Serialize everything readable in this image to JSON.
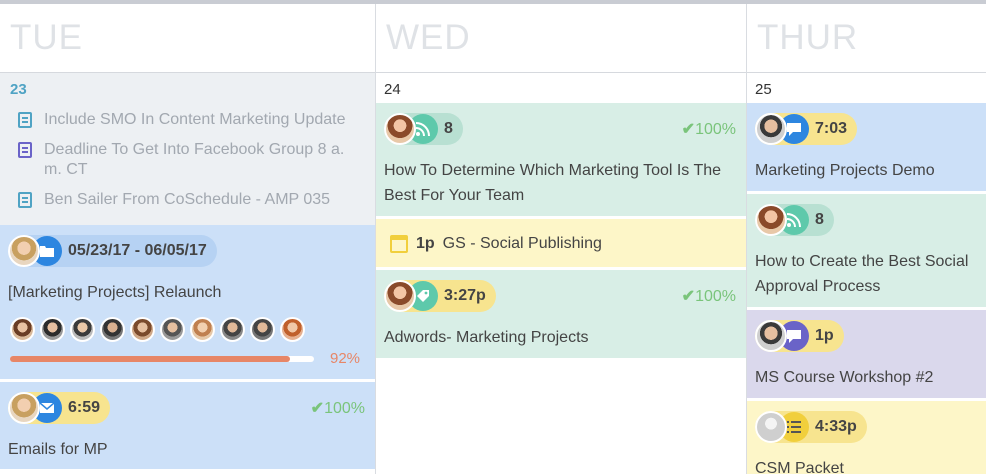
{
  "days": [
    {
      "label": "TUE",
      "num": "23"
    },
    {
      "label": "WED",
      "num": "24"
    },
    {
      "label": "THUR",
      "num": "25"
    }
  ],
  "tue": {
    "tasks": [
      {
        "text": "Include SMO In Content Marketing Update",
        "color": "#4fa3c4"
      },
      {
        "text": "Deadline To Get Into Facebook Group 8 a. m. CT",
        "color": "#6a63c8"
      },
      {
        "text": "Ben Sailer From CoSchedule - AMP 035",
        "color": "#4fa3c4"
      }
    ],
    "project": {
      "dates": "05/23/17 - 06/05/17",
      "title": "[Marketing Projects] Relaunch",
      "progress": 0.92,
      "progress_label": "92%"
    },
    "email": {
      "time": "6:59",
      "percent": "100%",
      "title": "Emails for MP"
    }
  },
  "wed": {
    "blog": {
      "count": "8",
      "percent": "100%",
      "title": "How To Determine Which Marketing Tool Is The Best For Your Team"
    },
    "event": {
      "time": "1p",
      "title": "GS - Social Publishing"
    },
    "adwords": {
      "time": "3:27p",
      "percent": "100%",
      "title": "Adwords- Marketing Projects"
    }
  },
  "thu": {
    "demo": {
      "time": "7:03",
      "title": "Marketing Projects Demo"
    },
    "blog": {
      "count": "8",
      "title": "How to Create the Best Social Approval Process"
    },
    "workshop": {
      "time": "1p",
      "title": "MS Course Workshop #2"
    },
    "packet": {
      "time": "4:33p",
      "title": "CSM Packet"
    }
  },
  "icons": {
    "check": "✔",
    "folder": "folder-icon",
    "rss": "rss-icon",
    "chat": "chat-icon",
    "tag": "tag-icon",
    "mail": "mail-icon",
    "list": "list-icon",
    "calendar": "calendar-icon"
  },
  "colors": {
    "accent_blue": "#2d86e0",
    "accent_green": "#5ec9ab",
    "accent_purple": "#6a63c8",
    "accent_yellow": "#f1cf3c",
    "progress": "#e78667",
    "success": "#7ac47b"
  }
}
